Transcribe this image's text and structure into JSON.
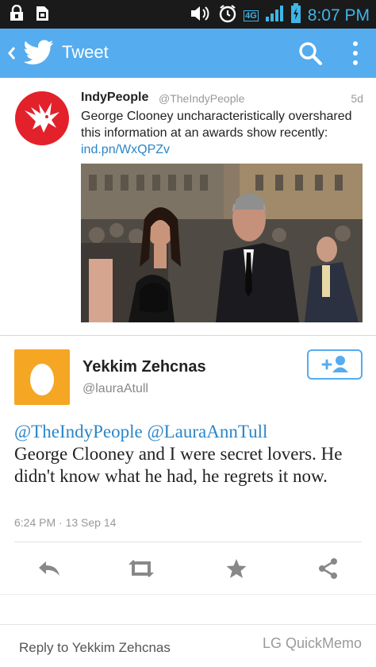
{
  "status_bar": {
    "time": "8:07 PM",
    "network": "4G",
    "icons": [
      "lock-notification-icon",
      "sim-notification-icon",
      "volume-icon",
      "alarm-clock-icon",
      "signal-icon",
      "battery-icon"
    ]
  },
  "app_bar": {
    "title": "Tweet",
    "icons": [
      "back-chevron-icon",
      "twitter-bird-icon",
      "search-icon",
      "overflow-menu-icon"
    ]
  },
  "quoted_tweet": {
    "name": "IndyPeople",
    "handle": "@TheIndyPeople",
    "time": "5d",
    "text_before_link": "George Clooney uncharacteristically overshared this information at an awards show recently: ",
    "link": "ind.pn/WxQPZv"
  },
  "main_tweet": {
    "name": "Yekkim Zehcnas",
    "handle": "@lauraAtull",
    "mention_1": "@TheIndyPeople",
    "mention_2": "@LauraAnnTull",
    "text": "George Clooney and I were secret lovers. He didn't know what he had, he regrets it now.",
    "timestamp": "6:24 PM · 13 Sep 14"
  },
  "actions": [
    "reply-icon",
    "retweet-icon",
    "favorite-star-icon",
    "share-icon"
  ],
  "reply_bar": {
    "placeholder": "Reply to Yekkim Zehcnas",
    "watermark": "LG QuickMemo"
  },
  "colors": {
    "twitter_blue": "#55acee",
    "link_blue": "#2a86c8",
    "indy_red": "#e3212b",
    "egg_orange": "#f5a623",
    "status_time": "#3fb5e8"
  }
}
